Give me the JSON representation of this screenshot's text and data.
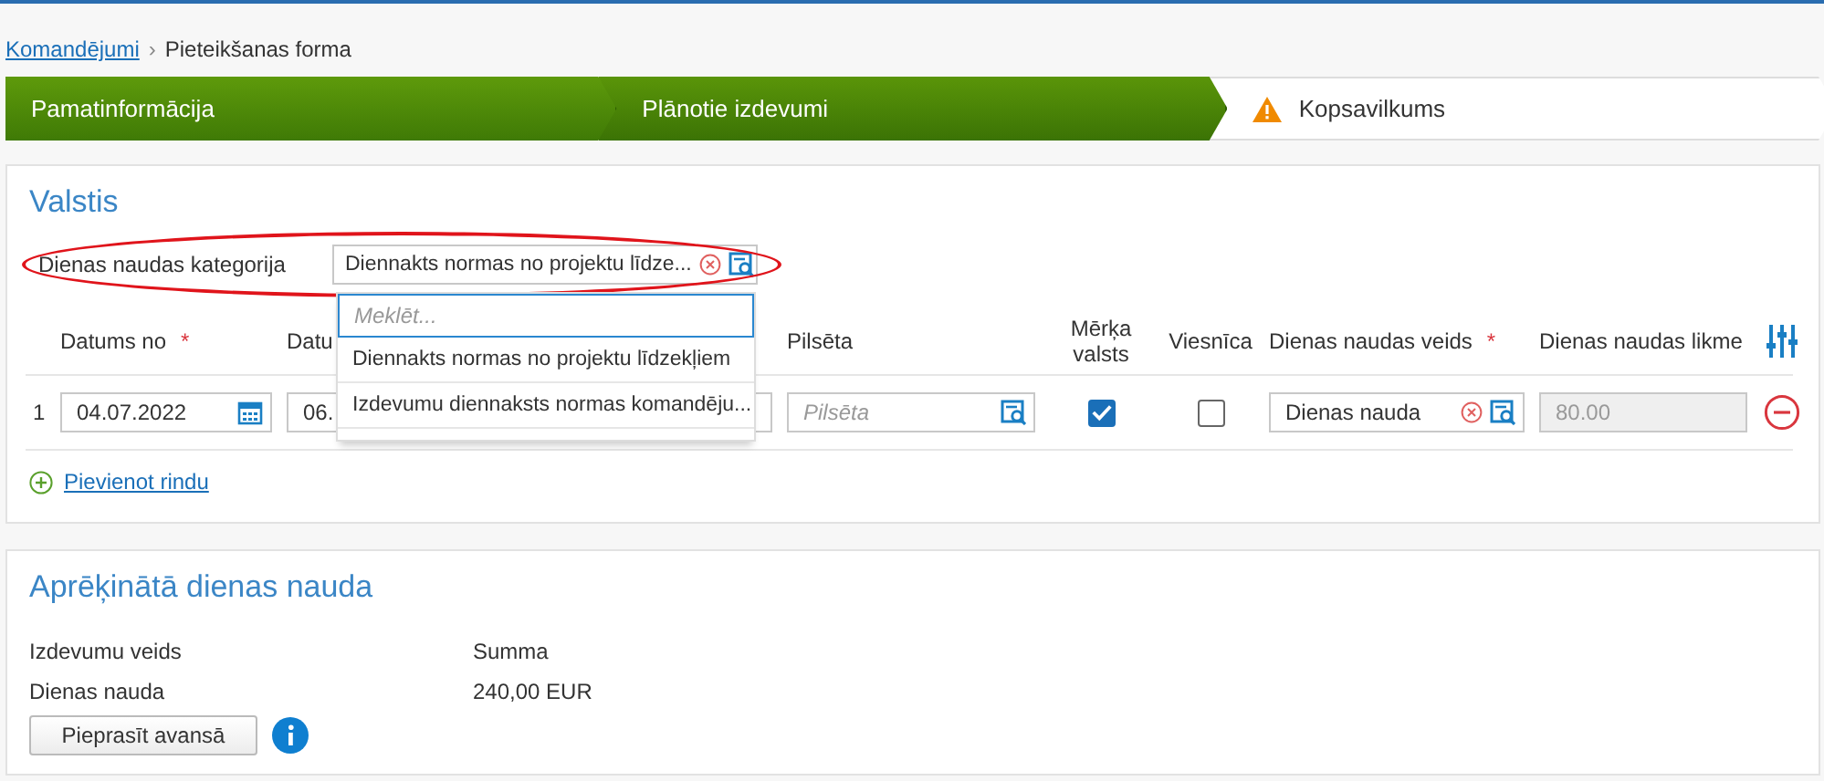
{
  "breadcrumb": {
    "link": "Komandējumi",
    "separator": "›",
    "current": "Pieteikšanas forma"
  },
  "steps": [
    {
      "label": "Pamatinformācija",
      "kind": "done"
    },
    {
      "label": "Plānotie izdevumi",
      "kind": "done"
    },
    {
      "label": "Kopsavilkums",
      "kind": "warning"
    }
  ],
  "countries": {
    "title": "Valstis",
    "category": {
      "label": "Dienas naudas kategorija",
      "value": "Diennakts normas no projektu līdze...",
      "highlighted": true,
      "dropdown": {
        "search_placeholder": "Meklēt...",
        "options": [
          "Diennakts normas no projektu līdzekļiem",
          "Izdevumu diennaksts normas komandēju..."
        ]
      }
    },
    "columns": [
      {
        "label": "Datums no",
        "required_mark": "*"
      },
      {
        "label": "Datu"
      },
      {
        "label": "Pilsēta"
      },
      {
        "label": "Mērķa valsts"
      },
      {
        "label": "Viesnīca"
      },
      {
        "label": "Dienas naudas veids",
        "required_mark": "*"
      },
      {
        "label": "Dienas naudas likme"
      }
    ],
    "rows": [
      {
        "number": "1",
        "date_from": "04.07.2022",
        "date_to": "06.",
        "city_placeholder": "Pilsēta",
        "target_country": true,
        "hotel": false,
        "allowance_type": "Dienas nauda",
        "rate": "80.00"
      }
    ],
    "add_row": "Pievienot rindu"
  },
  "calculated": {
    "title": "Aprēķinātā dienas nauda",
    "columns": [
      "Izdevumu veids",
      "Summa"
    ],
    "rows": [
      [
        "Dienas nauda",
        "240,00 EUR"
      ]
    ],
    "button": "Pieprasīt avansā"
  }
}
